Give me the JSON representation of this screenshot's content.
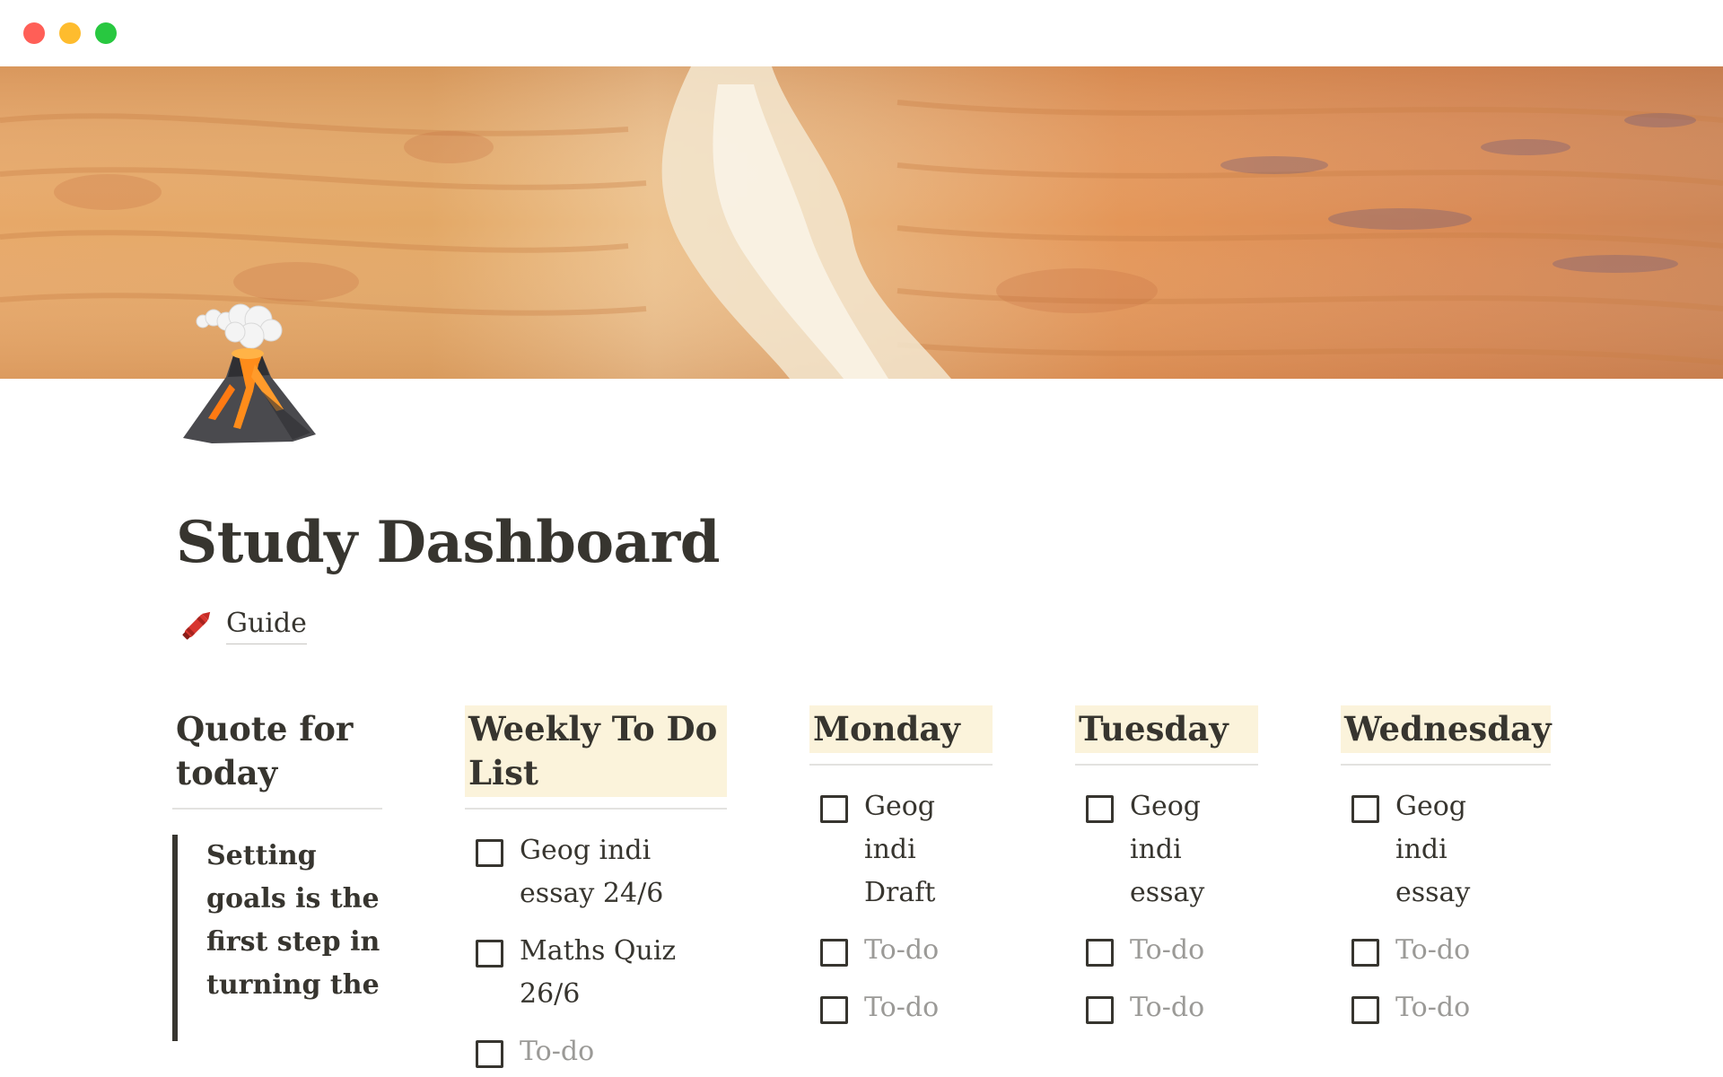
{
  "window": {
    "controls": [
      "close",
      "minimize",
      "maximize"
    ],
    "colors": {
      "close": "#ff5f57",
      "minimize": "#febc2e",
      "maximize": "#28c840"
    }
  },
  "cover": {
    "icon": "desert-aerial-cover-image"
  },
  "page": {
    "icon": "volcano-icon",
    "title": "Study Dashboard",
    "guide": {
      "icon": "crayon-icon",
      "label": "Guide"
    },
    "accent_highlight": "#fbf3db"
  },
  "quote_column": {
    "heading": "Quote for today",
    "quote": "Setting goals is the first step in turning the"
  },
  "weekly_column": {
    "heading": "Weekly To Do List",
    "items": [
      {
        "text": "Geog indi essay 24/6",
        "checked": false,
        "placeholder": false
      },
      {
        "text": "Maths Quiz 26/6",
        "checked": false,
        "placeholder": false
      },
      {
        "text": "To-do",
        "checked": false,
        "placeholder": true
      }
    ]
  },
  "days": [
    {
      "heading": "Monday",
      "items": [
        {
          "text": "Geog indi Draft",
          "checked": false,
          "placeholder": false
        },
        {
          "text": "To-do",
          "checked": false,
          "placeholder": true
        },
        {
          "text": "To-do",
          "checked": false,
          "placeholder": true
        }
      ]
    },
    {
      "heading": "Tuesday",
      "items": [
        {
          "text": "Geog indi essay",
          "checked": false,
          "placeholder": false
        },
        {
          "text": "To-do",
          "checked": false,
          "placeholder": true
        },
        {
          "text": "To-do",
          "checked": false,
          "placeholder": true
        }
      ]
    },
    {
      "heading": "Wednesday",
      "items": [
        {
          "text": "Geog indi essay",
          "checked": false,
          "placeholder": false
        },
        {
          "text": "To-do",
          "checked": false,
          "placeholder": true
        },
        {
          "text": "To-do",
          "checked": false,
          "placeholder": true
        }
      ]
    }
  ]
}
